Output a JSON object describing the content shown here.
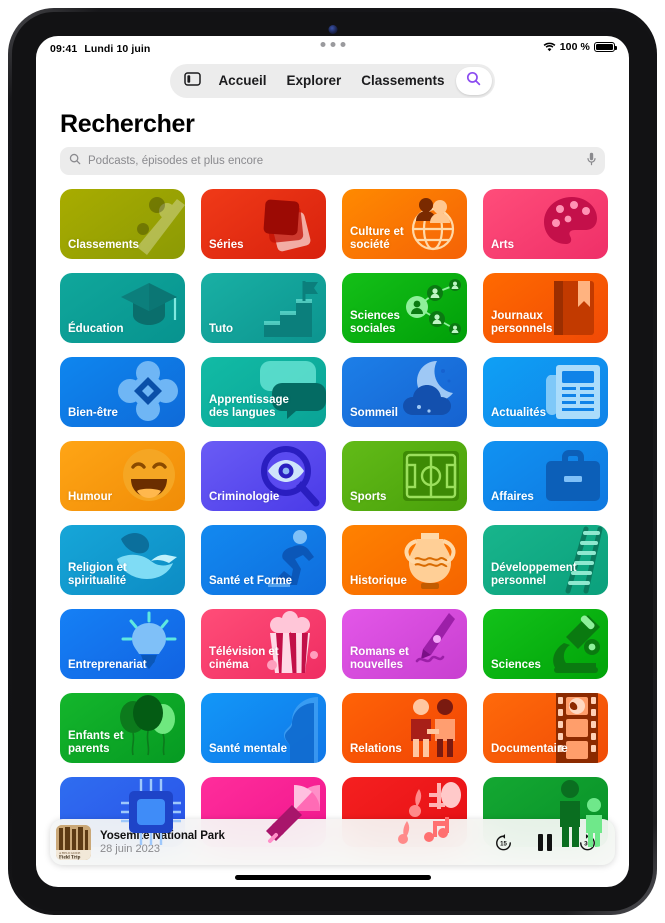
{
  "status_bar": {
    "time": "09:41",
    "date": "Lundi 10 juin",
    "wifi_icon": "wifi-icon",
    "battery_percent": "100 %",
    "battery_icon": "battery-icon"
  },
  "nav": {
    "sidebar_icon": "sidebar-toggle-icon",
    "items": [
      {
        "label": "Accueil",
        "name": "nav-tab-home"
      },
      {
        "label": "Explorer",
        "name": "nav-tab-browse"
      },
      {
        "label": "Classements",
        "name": "nav-tab-charts"
      }
    ],
    "search_icon": "search-icon",
    "search_icon_color": "#8b4cf0"
  },
  "header": {
    "title": "Rechercher",
    "search": {
      "placeholder": "Podcasts, épisodes et plus encore",
      "value": "",
      "leading_icon": "search-icon",
      "trailing_icon": "microphone-icon"
    }
  },
  "categories": [
    {
      "label": "Classements",
      "icon": "comet-icon",
      "c1": "#a8ac00",
      "c2": "#8c9a05"
    },
    {
      "label": "Séries",
      "icon": "stacked-cards-icon",
      "c1": "#f03a18",
      "c2": "#d8210d"
    },
    {
      "label": "Culture et société",
      "icon": "globe-people-icon",
      "c1": "#ff8a00",
      "c2": "#f56207"
    },
    {
      "label": "Arts",
      "icon": "palette-icon",
      "c1": "#ff4d7a",
      "c2": "#ef2f68"
    },
    {
      "label": "Éducation",
      "icon": "graduation-cap-icon",
      "c1": "#10a79b",
      "c2": "#07938f"
    },
    {
      "label": "Tuto",
      "icon": "stairs-flag-icon",
      "c1": "#19b0a4",
      "c2": "#0c948f"
    },
    {
      "label": "Sciences sociales",
      "icon": "people-network-icon",
      "c1": "#14c018",
      "c2": "#009f08"
    },
    {
      "label": "Journaux personnels",
      "icon": "book-bookmark-icon",
      "c1": "#ff6a00",
      "c2": "#f04906"
    },
    {
      "label": "Bien-être",
      "icon": "flower-diamond-icon",
      "c1": "#0e86ef",
      "c2": "#0f6ad8"
    },
    {
      "label": "Apprentissage des langues",
      "icon": "speech-bubbles-icon",
      "c1": "#12bba5",
      "c2": "#0aa396"
    },
    {
      "label": "Sommeil",
      "icon": "moon-cloud-icon",
      "c1": "#1c7fe8",
      "c2": "#1662d0"
    },
    {
      "label": "Actualités",
      "icon": "newspaper-icon",
      "c1": "#0fa0f5",
      "c2": "#1083e8"
    },
    {
      "label": "Humour",
      "icon": "laughing-face-icon",
      "c1": "#ffa515",
      "c2": "#f08c07"
    },
    {
      "label": "Criminologie",
      "icon": "magnifier-eye-icon",
      "c1": "#6a5cf5",
      "c2": "#4a3ae8"
    },
    {
      "label": "Sports",
      "icon": "soccer-field-icon",
      "c1": "#62bb18",
      "c2": "#49a00a"
    },
    {
      "label": "Affaires",
      "icon": "briefcase-icon",
      "c1": "#1092f2",
      "c2": "#0f78e0"
    },
    {
      "label": "Religion et spiritualité",
      "icon": "dove-icon",
      "c1": "#16a6d8",
      "c2": "#0d8cc4"
    },
    {
      "label": "Santé et Forme",
      "icon": "runner-icon",
      "c1": "#1289f0",
      "c2": "#0f6ddd"
    },
    {
      "label": "Historique",
      "icon": "amphora-icon",
      "c1": "#ff8200",
      "c2": "#f56400"
    },
    {
      "label": "Développement personnel",
      "icon": "ladder-icon",
      "c1": "#18b58c",
      "c2": "#0ba07c"
    },
    {
      "label": "Entreprenariat",
      "icon": "lightbulb-icon",
      "c1": "#1580f5",
      "c2": "#1263e2"
    },
    {
      "label": "Télévision et cinéma",
      "icon": "popcorn-icon",
      "c1": "#ff4d78",
      "c2": "#ef2d62"
    },
    {
      "label": "Romans et nouvelles",
      "icon": "fountain-pen-icon",
      "c1": "#e357e8",
      "c2": "#c83fd0"
    },
    {
      "label": "Sciences",
      "icon": "microscope-icon",
      "c1": "#13c21a",
      "c2": "#00a308"
    },
    {
      "label": "Enfants et parents",
      "icon": "balloons-icon",
      "c1": "#14b62c",
      "c2": "#069a22"
    },
    {
      "label": "Santé mentale",
      "icon": "head-profile-icon",
      "c1": "#1297f8",
      "c2": "#1077e8"
    },
    {
      "label": "Relations",
      "icon": "two-people-icon",
      "c1": "#ff6306",
      "c2": "#f04405"
    },
    {
      "label": "Documentaire",
      "icon": "film-strip-icon",
      "c1": "#ff6a0a",
      "c2": "#f04b06"
    },
    {
      "label": "",
      "icon": "microchip-icon",
      "c1": "#2f6df0",
      "c2": "#2a52e8"
    },
    {
      "label": "",
      "icon": "umbrella-icon",
      "c1": "#ff2d9b",
      "c2": "#f0168d"
    },
    {
      "label": "",
      "icon": "music-notes-icon",
      "c1": "#f52020",
      "c2": "#e50f14"
    },
    {
      "label": "",
      "icon": "parent-child-icon",
      "c1": "#14a832",
      "c2": "#089028"
    }
  ],
  "now_playing": {
    "artwork_icon": "podcast-artwork",
    "artwork_caption": "Field Trip",
    "title": "Yosemite National Park",
    "date": "28 juin 2023",
    "controls": [
      {
        "name": "skip-back-15-button",
        "label": "15"
      },
      {
        "name": "pause-button",
        "label": ""
      },
      {
        "name": "skip-forward-30-button",
        "label": "30"
      }
    ]
  }
}
